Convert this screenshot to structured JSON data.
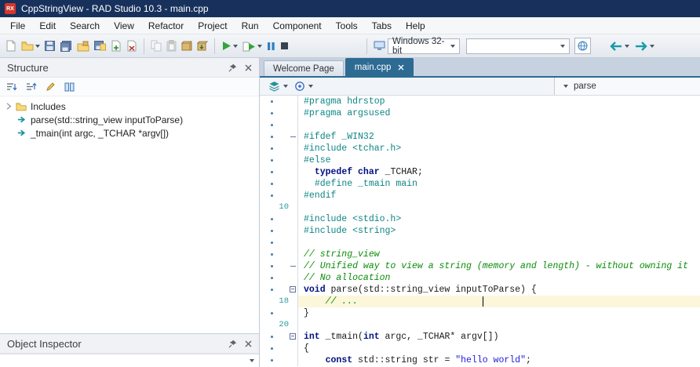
{
  "window": {
    "title": "CppStringView - RAD Studio 10.3 - main.cpp",
    "logo_text": "RX"
  },
  "menubar": [
    "File",
    "Edit",
    "Search",
    "View",
    "Refactor",
    "Project",
    "Run",
    "Component",
    "Tools",
    "Tabs",
    "Help"
  ],
  "toolbar": {
    "platform_select": "Windows 32-bit",
    "search_value": ""
  },
  "structure_panel": {
    "title": "Structure",
    "tree": [
      {
        "label": "Includes",
        "icon": "folder",
        "expandable": true
      },
      {
        "label": "parse(std::string_view inputToParse)",
        "icon": "member"
      },
      {
        "label": "_tmain(int argc, _TCHAR *argv[])",
        "icon": "member"
      }
    ]
  },
  "object_inspector": {
    "title": "Object Inspector",
    "selector_value": ""
  },
  "editor": {
    "tabs": [
      {
        "label": "Welcome Page",
        "active": false,
        "closable": false
      },
      {
        "label": "main.cpp",
        "active": true,
        "closable": true
      }
    ],
    "search_value": "parse",
    "lines": [
      {
        "toks": [
          [
            "pp",
            "#pragma hdrstop"
          ]
        ]
      },
      {
        "toks": [
          [
            "pp",
            "#pragma argsused"
          ]
        ]
      },
      {
        "toks": []
      },
      {
        "mark": "minus",
        "toks": [
          [
            "pp",
            "#ifdef _WIN32"
          ]
        ]
      },
      {
        "toks": [
          [
            "pp",
            "#include <tchar.h>"
          ]
        ]
      },
      {
        "toks": [
          [
            "pp",
            "#else"
          ]
        ]
      },
      {
        "toks": [
          [
            "pl",
            "  "
          ],
          [
            "kw",
            "typedef"
          ],
          [
            "pl",
            " "
          ],
          [
            "kw",
            "char"
          ],
          [
            "pl",
            " _TCHAR;"
          ]
        ]
      },
      {
        "toks": [
          [
            "pl",
            "  "
          ],
          [
            "pp",
            "#define _tmain main"
          ]
        ]
      },
      {
        "toks": [
          [
            "pp",
            "#endif"
          ]
        ]
      },
      {
        "num": "10",
        "toks": []
      },
      {
        "toks": [
          [
            "pp",
            "#include <stdio.h>"
          ]
        ]
      },
      {
        "toks": [
          [
            "pp",
            "#include <string>"
          ]
        ]
      },
      {
        "toks": []
      },
      {
        "toks": [
          [
            "cm",
            "// string_view"
          ]
        ]
      },
      {
        "mark": "minus",
        "toks": [
          [
            "cm",
            "// Unified way to view a string (memory and length) - without owning it"
          ]
        ]
      },
      {
        "toks": [
          [
            "cm",
            "// No allocation"
          ]
        ]
      },
      {
        "mark": "box",
        "toks": [
          [
            "kw",
            "void"
          ],
          [
            "pl",
            " parse(std::string_view inputToParse) {"
          ]
        ]
      },
      {
        "num": "18",
        "current": true,
        "toks": [
          [
            "cm",
            "    // ..."
          ]
        ]
      },
      {
        "toks": [
          [
            "pl",
            "}"
          ]
        ]
      },
      {
        "num": "20",
        "toks": []
      },
      {
        "mark": "box",
        "toks": [
          [
            "kw",
            "int"
          ],
          [
            "pl",
            " _tmain("
          ],
          [
            "kw",
            "int"
          ],
          [
            "pl",
            " argc, _TCHAR* argv[])"
          ]
        ]
      },
      {
        "toks": [
          [
            "pl",
            "{"
          ]
        ]
      },
      {
        "toks": [
          [
            "pl",
            "    "
          ],
          [
            "kw",
            "const"
          ],
          [
            "pl",
            " std::string str = "
          ],
          [
            "str",
            "\"hello world\""
          ],
          [
            "pl",
            ";"
          ]
        ]
      }
    ]
  },
  "colors": {
    "titlebar": "#17315c",
    "accent": "#2d6b93",
    "keyword": "#00117f",
    "preprocessor": "#0e8585",
    "comment": "#0a8c0a",
    "string": "#2121d6",
    "line_highlight": "#fcf7da"
  }
}
